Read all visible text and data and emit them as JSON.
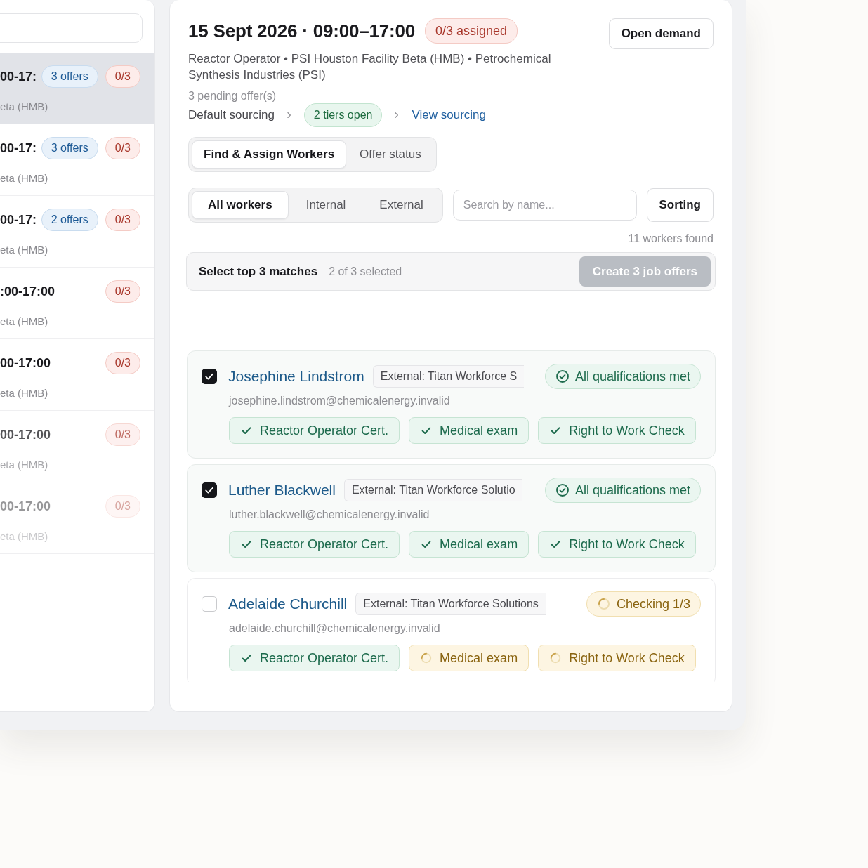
{
  "sidebar": {
    "items": [
      {
        "time": "00-17:",
        "offers": "3 offers",
        "assigned": "0/3",
        "location": "eta (HMB)",
        "selected": true
      },
      {
        "time": "00-17:",
        "offers": "3 offers",
        "assigned": "0/3",
        "location": "eta (HMB)",
        "selected": false
      },
      {
        "time": "00-17:",
        "offers": "2 offers",
        "assigned": "0/3",
        "location": "eta (HMB)",
        "selected": false
      },
      {
        "time": ":00-17:00",
        "assigned": "0/3",
        "location": "eta (HMB)",
        "selected": false
      },
      {
        "time": "00-17:00",
        "assigned": "0/3",
        "location": "eta (HMB)",
        "selected": false
      },
      {
        "time": "00-17:00",
        "assigned": "0/3",
        "location": "eta (HMB)",
        "selected": false
      },
      {
        "time": "00-17:00",
        "assigned": "0/3",
        "location": "eta (HMB)",
        "selected": false
      }
    ]
  },
  "demand": {
    "title": "15 Sept 2026 · 09:00–17:00",
    "assigned_badge": "0/3 assigned",
    "open_button": "Open demand",
    "details": "Reactor Operator • PSI Houston Facility Beta (HMB) • Petrochemical Synthesis Industries (PSI)",
    "pending": "3 pending offer(s)",
    "sourcing": {
      "label": "Default sourcing",
      "tiers": "2 tiers open",
      "link": "View sourcing"
    }
  },
  "tabs": [
    {
      "label": "Find & Assign Workers",
      "selected": true
    },
    {
      "label": "Offer status",
      "selected": false
    }
  ],
  "filters": [
    {
      "label": "All workers",
      "selected": true
    },
    {
      "label": "Internal",
      "selected": false
    },
    {
      "label": "External",
      "selected": false
    }
  ],
  "search": {
    "placeholder": "Search by name..."
  },
  "sorting_button": "Sorting",
  "result_count": "11 workers found",
  "selection_bar": {
    "label": "Select top 3 matches",
    "count": "2 of 3 selected",
    "button": {
      "label": "Create 3 job offers",
      "disabled": true
    }
  },
  "workers": [
    {
      "name": "Josephine Lindstrom",
      "source": "External: Titan Workforce S",
      "email": "josephine.lindstrom@chemicalenergy.invalid",
      "selected": true,
      "status": {
        "kind": "met",
        "label": "All qualifications met"
      },
      "qualifications": [
        {
          "label": "Reactor Operator Cert.",
          "kind": "met"
        },
        {
          "label": "Medical exam",
          "kind": "met"
        },
        {
          "label": "Right to Work Check",
          "kind": "met"
        }
      ]
    },
    {
      "name": "Luther Blackwell",
      "source": "External: Titan Workforce Solutio",
      "email": "luther.blackwell@chemicalenergy.invalid",
      "selected": true,
      "status": {
        "kind": "met",
        "label": "All qualifications met"
      },
      "qualifications": [
        {
          "label": "Reactor Operator Cert.",
          "kind": "met"
        },
        {
          "label": "Medical exam",
          "kind": "met"
        },
        {
          "label": "Right to Work Check",
          "kind": "met"
        }
      ]
    },
    {
      "name": "Adelaide Churchill",
      "source": "External: Titan Workforce Solutions",
      "email": "adelaide.churchill@chemicalenergy.invalid",
      "selected": false,
      "status": {
        "kind": "checking",
        "label": "Checking 1/3"
      },
      "qualifications": [
        {
          "label": "Reactor Operator Cert.",
          "kind": "met"
        },
        {
          "label": "Medical exam",
          "kind": "checking"
        },
        {
          "label": "Right to Work Check",
          "kind": "checking"
        }
      ]
    }
  ]
}
